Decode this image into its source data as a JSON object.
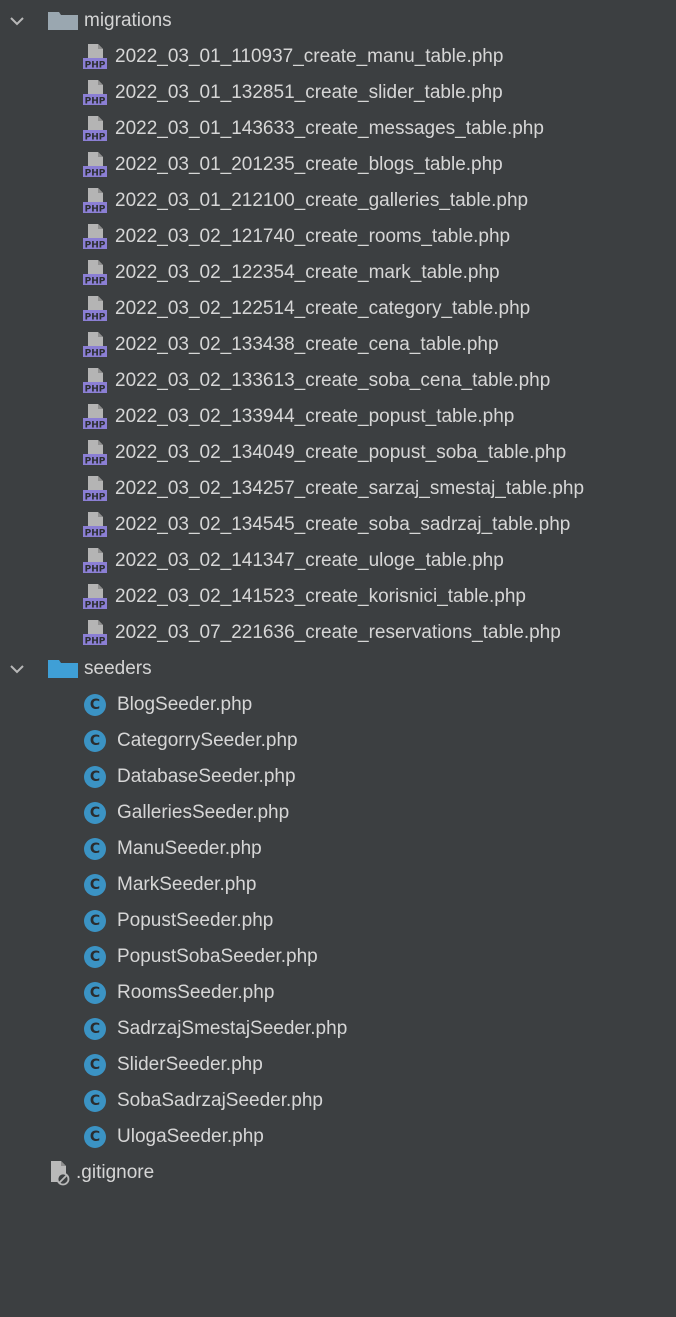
{
  "tree": {
    "migrations": {
      "label": "migrations",
      "files": [
        "2022_03_01_110937_create_manu_table.php",
        "2022_03_01_132851_create_slider_table.php",
        "2022_03_01_143633_create_messages_table.php",
        "2022_03_01_201235_create_blogs_table.php",
        "2022_03_01_212100_create_galleries_table.php",
        "2022_03_02_121740_create_rooms_table.php",
        "2022_03_02_122354_create_mark_table.php",
        "2022_03_02_122514_create_category_table.php",
        "2022_03_02_133438_create_cena_table.php",
        "2022_03_02_133613_create_soba_cena_table.php",
        "2022_03_02_133944_create_popust_table.php",
        "2022_03_02_134049_create_popust_soba_table.php",
        "2022_03_02_134257_create_sarzaj_smestaj_table.php",
        "2022_03_02_134545_create_soba_sadrzaj_table.php",
        "2022_03_02_141347_create_uloge_table.php",
        "2022_03_02_141523_create_korisnici_table.php",
        "2022_03_07_221636_create_reservations_table.php"
      ]
    },
    "seeders": {
      "label": "seeders",
      "files": [
        "BlogSeeder.php",
        "CategorrySeeder.php",
        "DatabaseSeeder.php",
        "GalleriesSeeder.php",
        "ManuSeeder.php",
        "MarkSeeder.php",
        "PopustSeeder.php",
        "PopustSobaSeeder.php",
        "RoomsSeeder.php",
        "SadrzajSmestajSeeder.php",
        "SliderSeeder.php",
        "SobaSadrzajSeeder.php",
        "UlogaSeeder.php"
      ]
    },
    "gitignore": {
      "label": ".gitignore"
    }
  },
  "icons": {
    "folder": "folder-icon",
    "php_file": "php-file-icon",
    "class_file": "class-file-icon",
    "ignore_file": "gitignore-file-icon",
    "expand": "chevron-down-icon"
  },
  "colors": {
    "background": "#3c3f41",
    "text": "#d6d6d6",
    "folder_migrations": "#9aa7b0",
    "folder_seeders": "#3f9fd6",
    "php_icon_purple": "#8b7fd4",
    "php_icon_grey": "#b4b4b4",
    "class_icon": "#3b93c4"
  }
}
